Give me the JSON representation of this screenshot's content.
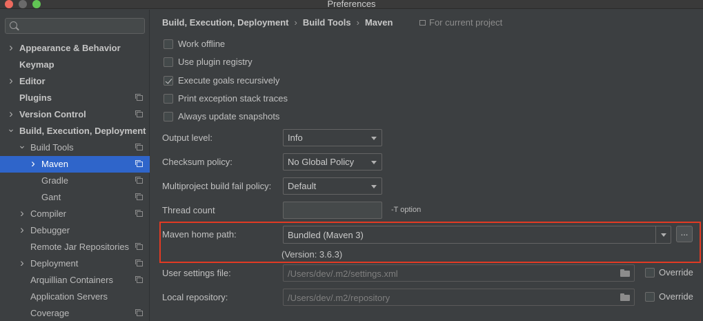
{
  "window": {
    "title": "Preferences"
  },
  "search": {
    "placeholder": ""
  },
  "sidebar": {
    "items": [
      {
        "label": "Appearance & Behavior",
        "arrow": "right",
        "bold": true,
        "indent": 0,
        "project": false
      },
      {
        "label": "Keymap",
        "arrow": "",
        "bold": true,
        "indent": 0,
        "project": false
      },
      {
        "label": "Editor",
        "arrow": "right",
        "bold": true,
        "indent": 0,
        "project": false
      },
      {
        "label": "Plugins",
        "arrow": "",
        "bold": true,
        "indent": 0,
        "project": true
      },
      {
        "label": "Version Control",
        "arrow": "right",
        "bold": true,
        "indent": 0,
        "project": true
      },
      {
        "label": "Build, Execution, Deployment",
        "arrow": "down",
        "bold": true,
        "indent": 0,
        "project": false
      },
      {
        "label": "Build Tools",
        "arrow": "down",
        "bold": false,
        "indent": 1,
        "project": true
      },
      {
        "label": "Maven",
        "arrow": "right",
        "bold": false,
        "indent": 2,
        "project": true,
        "selected": true
      },
      {
        "label": "Gradle",
        "arrow": "",
        "bold": false,
        "indent": 2,
        "project": true
      },
      {
        "label": "Gant",
        "arrow": "",
        "bold": false,
        "indent": 2,
        "project": true
      },
      {
        "label": "Compiler",
        "arrow": "right",
        "bold": false,
        "indent": 1,
        "project": true
      },
      {
        "label": "Debugger",
        "arrow": "right",
        "bold": false,
        "indent": 1,
        "project": false
      },
      {
        "label": "Remote Jar Repositories",
        "arrow": "",
        "bold": false,
        "indent": 1,
        "project": true
      },
      {
        "label": "Deployment",
        "arrow": "right",
        "bold": false,
        "indent": 1,
        "project": true
      },
      {
        "label": "Arquillian Containers",
        "arrow": "",
        "bold": false,
        "indent": 1,
        "project": true
      },
      {
        "label": "Application Servers",
        "arrow": "",
        "bold": false,
        "indent": 1,
        "project": false
      },
      {
        "label": "Coverage",
        "arrow": "",
        "bold": false,
        "indent": 1,
        "project": true
      }
    ]
  },
  "breadcrumb": {
    "parts": [
      "Build, Execution, Deployment",
      "Build Tools",
      "Maven"
    ],
    "separator": "›",
    "scope": "For current project"
  },
  "checkboxes": [
    {
      "label": "Work offline",
      "checked": false
    },
    {
      "label": "Use plugin registry",
      "checked": false
    },
    {
      "label": "Execute goals recursively",
      "checked": true
    },
    {
      "label": "Print exception stack traces",
      "checked": false
    },
    {
      "label": "Always update snapshots",
      "checked": false
    }
  ],
  "fields": {
    "output_level": {
      "label": "Output level:",
      "value": "Info"
    },
    "checksum_policy": {
      "label": "Checksum policy:",
      "value": "No Global Policy"
    },
    "multiproject_fail": {
      "label": "Multiproject build fail policy:",
      "value": "Default"
    },
    "thread_count": {
      "label": "Thread count",
      "value": "",
      "hint": "-T option"
    },
    "maven_home": {
      "label": "Maven home path:",
      "value": "Bundled (Maven 3)",
      "browse": "...",
      "version": "(Version: 3.6.3)"
    },
    "user_settings": {
      "label": "User settings file:",
      "value": "/Users/dev/.m2/settings.xml",
      "override": "Override"
    },
    "local_repo": {
      "label": "Local repository:",
      "value": "/Users/dev/.m2/repository",
      "override": "Override"
    }
  },
  "colors": {
    "selection": "#2f65ca",
    "highlight": "#e23a23",
    "background": "#3c3f41"
  }
}
